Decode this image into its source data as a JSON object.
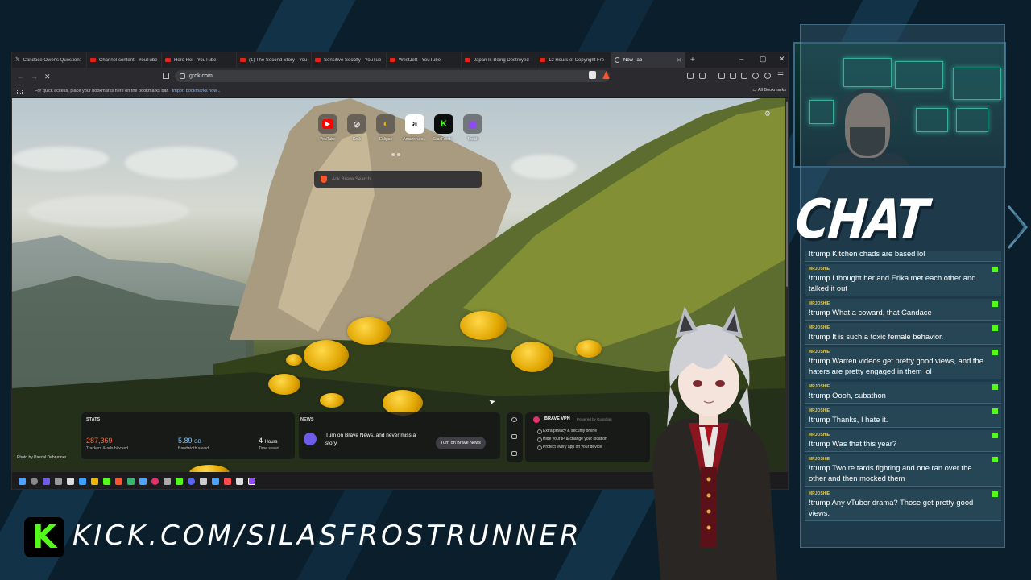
{
  "browser": {
    "tabs": [
      {
        "label": "Candace Owens Question:",
        "favicon": "x-icon"
      },
      {
        "label": "Channel content - YouTube",
        "favicon": "youtube-icon"
      },
      {
        "label": "Hero Hei - YouTube",
        "favicon": "youtube-icon"
      },
      {
        "label": "(1) The Second Story - You",
        "favicon": "youtube-icon"
      },
      {
        "label": "Sensitive Soci3ty - YouTub",
        "favicon": "youtube-icon"
      },
      {
        "label": "WestJett - YouTube",
        "favicon": "youtube-icon"
      },
      {
        "label": "Japan Is Being Destroyed",
        "favicon": "youtube-icon"
      },
      {
        "label": "12 Hours of Copyright Fre",
        "favicon": "youtube-icon"
      }
    ],
    "active_tab": "New Tab",
    "url": "grok.com",
    "bookmarks_hint": "For quick access, place your bookmarks here on the bookmarks bar.",
    "import_link": "Import bookmarks now...",
    "all_bookmarks": "All Bookmarks"
  },
  "newtab": {
    "shortcuts": [
      {
        "label": "YouTube",
        "icon": "youtube-icon",
        "glyph": "▶",
        "color": "#ff0000"
      },
      {
        "label": "Grok",
        "icon": "grok-icon",
        "glyph": "⊘",
        "color": "#dddddd"
      },
      {
        "label": "Eklipse",
        "icon": "eklipse-icon",
        "glyph": "◐",
        "color": "#e8b800"
      },
      {
        "label": "Amazon.co...",
        "icon": "amazon-icon",
        "glyph": "a",
        "color": "#222222"
      },
      {
        "label": "SilasFrostr...",
        "icon": "kick-icon",
        "glyph": "K",
        "color": "#53fc18"
      },
      {
        "label": "Twitch",
        "icon": "twitch-icon",
        "glyph": "▣",
        "color": "#9146ff"
      }
    ],
    "search_placeholder": "Ask Brave Search",
    "stats": {
      "header": "STATS",
      "trackers_value": "287,369",
      "trackers_label": "Trackers & ads blocked",
      "bandwidth_value": "5.89",
      "bandwidth_unit": "GB",
      "bandwidth_label": "Bandwidth saved",
      "time_value": "4",
      "time_unit": "Hours",
      "time_label": "Time saved"
    },
    "news": {
      "header": "NEWS",
      "text": "Turn on Brave News, and never miss a story",
      "button": "Turn on Brave News"
    },
    "vpn": {
      "title": "BRAVE VPN",
      "powered": "Powered by Guardian",
      "features": [
        "Extra privacy & security online",
        "Hide your IP & change your location",
        "Protect every app on your device"
      ]
    },
    "photo_credit": "Photo by Pascal Debrunner"
  },
  "chat": {
    "title": "CHAT",
    "messages": [
      {
        "user": "",
        "text": "!trump Kitchen chads are based lol"
      },
      {
        "user": "MRJOSHIE",
        "text": "!trump I thought her and Erika met each other and talked it out"
      },
      {
        "user": "MRJOSHIE",
        "text": "!trump What a coward, that Candace"
      },
      {
        "user": "MRJOSHIE",
        "text": "!trump It is such a toxic female behavior."
      },
      {
        "user": "MRJOSHIE",
        "text": "!trump Warren videos get pretty good views, and the haters are pretty engaged in them lol"
      },
      {
        "user": "MRJOSHIE",
        "text": "!trump Oooh, subathon"
      },
      {
        "user": "MRJOSHIE",
        "text": "!trump Thanks, I hate it."
      },
      {
        "user": "MRJOSHIE",
        "text": "!trump Was that this year?"
      },
      {
        "user": "MRJOSHIE",
        "text": "!trump Two re tards fighting and one ran over the other and then mocked them"
      },
      {
        "user": "MRJOSHIE",
        "text": "!trump Any vTuber drama? Those get pretty good views."
      }
    ]
  },
  "overlay": {
    "kick_url": "KICK.COM/SILASFROSTRUNNER",
    "kick_logo": "K"
  }
}
